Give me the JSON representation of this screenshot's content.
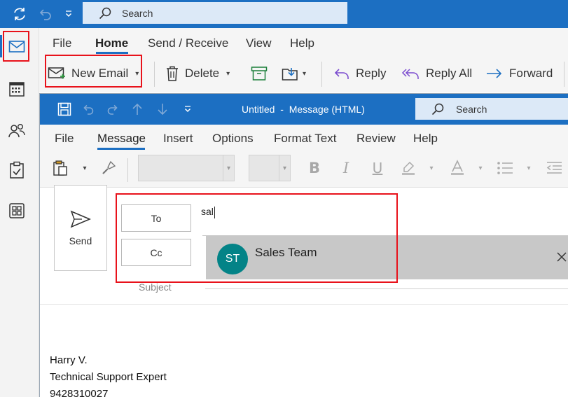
{
  "outer": {
    "search_label": "Search",
    "tabs": [
      "File",
      "Home",
      "Send / Receive",
      "View",
      "Help"
    ],
    "buttons": {
      "new_email": "New Email",
      "delete": "Delete",
      "reply": "Reply",
      "reply_all": "Reply All",
      "forward": "Forward"
    }
  },
  "message_window": {
    "title": "Untitled  -  Message (HTML)",
    "search_label": "Search",
    "tabs": [
      "File",
      "Message",
      "Insert",
      "Options",
      "Format Text",
      "Review",
      "Help"
    ]
  },
  "compose": {
    "send_label": "Send",
    "to_label": "To",
    "cc_label": "Cc",
    "to_value": "sal",
    "subject_label": "Subject",
    "suggestion": {
      "initials": "ST",
      "name": "Sales Team"
    },
    "signature": [
      "Harry V.",
      "Technical Support Expert",
      "9428310027"
    ]
  },
  "colors": {
    "brand_blue": "#1c6fc2",
    "highlight_red": "#e8121b",
    "avatar_teal": "#038387"
  }
}
